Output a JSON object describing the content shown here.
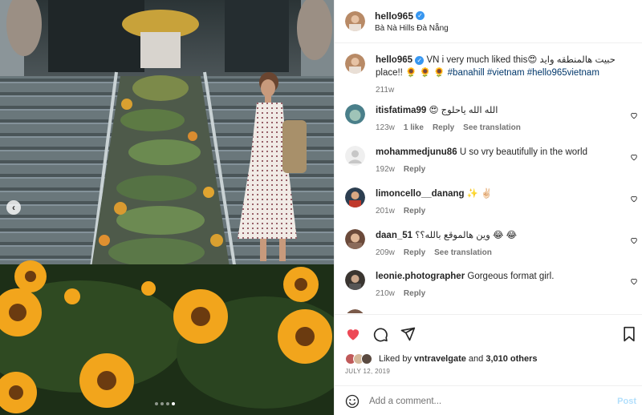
{
  "post": {
    "author": "hello965",
    "location": "Bà Nà Hills Đà Nẵng",
    "caption_prefix": "VN i very much liked this",
    "caption_emoji": "😍",
    "caption_arabic": "حبيت هالمنطقه وايد",
    "caption_line2": "place!!",
    "caption_emojis2": "🌻 🌻 🌻",
    "caption_tags": "#banahill #vietnam #hello965vietnam",
    "caption_time": "211w"
  },
  "comments": [
    {
      "user": "itisfatima99",
      "text": "😍 الله الله ياحلوج",
      "time": "123w",
      "likes": "1 like",
      "reply": "Reply",
      "translate": "See translation",
      "avatar_color": "#4a7f8a"
    },
    {
      "user": "mohammedjunu86",
      "text": "U so vry beautifully in the world",
      "time": "192w",
      "reply": "Reply",
      "avatar_color": "#dbdbdb"
    },
    {
      "user": "limoncello__danang",
      "text": "✨ ✌🏻",
      "time": "201w",
      "reply": "Reply",
      "avatar_color": "#2c3e50"
    },
    {
      "user": "daan_51",
      "text": "وين هالموقع بالله؟؟ 😂 😂",
      "time": "209w",
      "reply": "Reply",
      "translate": "See translation",
      "avatar_color": "#6b4a3a"
    },
    {
      "user": "leonie.photographer",
      "text": "Gorgeous format girl.",
      "time": "210w",
      "reply": "Reply",
      "avatar_color": "#3a3530"
    }
  ],
  "likes": {
    "prefix": "Liked by",
    "user": "vntravelgate",
    "conjunction": "and",
    "count": "3,010 others"
  },
  "date": "JULY 12, 2019",
  "add_comment": {
    "placeholder": "Add a comment...",
    "post_label": "Post"
  },
  "colors": {
    "liked_heart": "#ed4956",
    "link": "#00376b",
    "verified": "#3897f0"
  }
}
